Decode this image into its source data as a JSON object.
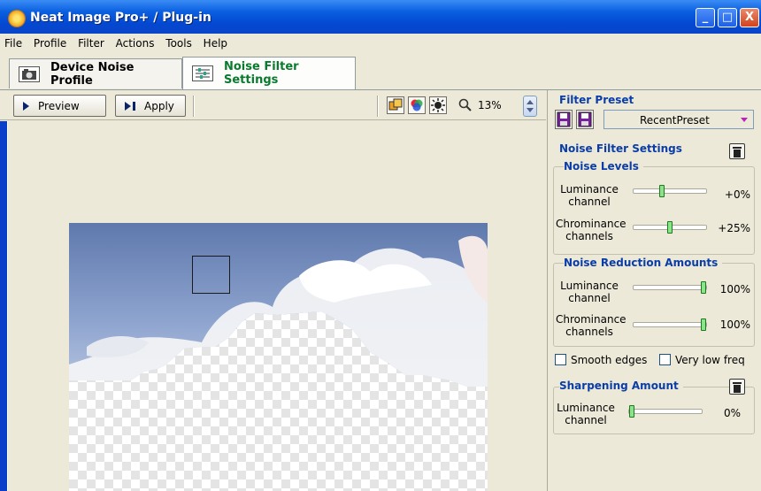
{
  "window": {
    "title": "Neat Image Pro+ / Plug-in",
    "controls": [
      "_",
      "□",
      "X"
    ]
  },
  "menu": [
    "File",
    "Profile",
    "Filter",
    "Actions",
    "Tools",
    "Help"
  ],
  "tabs": [
    {
      "label": "Device Noise Profile",
      "icon": "camera-icon"
    },
    {
      "label": "Noise Filter Settings",
      "icon": "sliders-icon"
    }
  ],
  "toolbar": {
    "preview_label": "Preview",
    "apply_label": "Apply",
    "zoom": "13%"
  },
  "panel": {
    "filter_preset_title": "Filter Preset",
    "preset_value": "RecentPreset",
    "noise_filter_title": "Noise Filter Settings",
    "noise_levels_title": "Noise Levels",
    "noise_levels": [
      {
        "label": "Luminance channel",
        "value": "+0%",
        "position": 0.4
      },
      {
        "label": "Chrominance channels",
        "value": "+25%",
        "position": 0.5
      }
    ],
    "reduction_title": "Noise Reduction Amounts",
    "reduction": [
      {
        "label": "Luminance channel",
        "value": "100%",
        "position": 1.0
      },
      {
        "label": "Chrominance channels",
        "value": "100%",
        "position": 1.0
      }
    ],
    "smooth_edges_label": "Smooth edges",
    "very_low_freq_label": "Very low freq",
    "sharpening_title": "Sharpening Amount",
    "sharpening": {
      "label": "Luminance channel",
      "value": "0%",
      "position": 0.0
    }
  },
  "colors": {
    "title_blue": "#0348D2",
    "section_title": "#0A3DA8",
    "active_tab_text": "#0A7A2E",
    "window_bg": "#ECE9D8"
  }
}
